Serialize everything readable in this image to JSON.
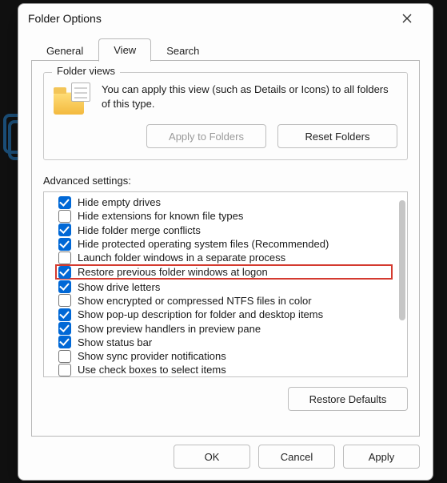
{
  "window": {
    "title": "Folder Options"
  },
  "tabs": {
    "general": "General",
    "view": "View",
    "search": "Search",
    "active": "view"
  },
  "folder_views": {
    "legend": "Folder views",
    "description": "You can apply this view (such as Details or Icons) to all folders of this type.",
    "apply_btn": "Apply to Folders",
    "reset_btn": "Reset Folders"
  },
  "advanced": {
    "label": "Advanced settings:",
    "restore_btn": "Restore Defaults",
    "items": [
      {
        "label": "Hide empty drives",
        "checked": true
      },
      {
        "label": "Hide extensions for known file types",
        "checked": false
      },
      {
        "label": "Hide folder merge conflicts",
        "checked": true
      },
      {
        "label": "Hide protected operating system files (Recommended)",
        "checked": true
      },
      {
        "label": "Launch folder windows in a separate process",
        "checked": false
      },
      {
        "label": "Restore previous folder windows at logon",
        "checked": true,
        "highlight": true
      },
      {
        "label": "Show drive letters",
        "checked": true
      },
      {
        "label": "Show encrypted or compressed NTFS files in color",
        "checked": false
      },
      {
        "label": "Show pop-up description for folder and desktop items",
        "checked": true
      },
      {
        "label": "Show preview handlers in preview pane",
        "checked": true
      },
      {
        "label": "Show status bar",
        "checked": true
      },
      {
        "label": "Show sync provider notifications",
        "checked": false
      },
      {
        "label": "Use check boxes to select items",
        "checked": false
      }
    ]
  },
  "buttons": {
    "ok": "OK",
    "cancel": "Cancel",
    "apply": "Apply"
  }
}
